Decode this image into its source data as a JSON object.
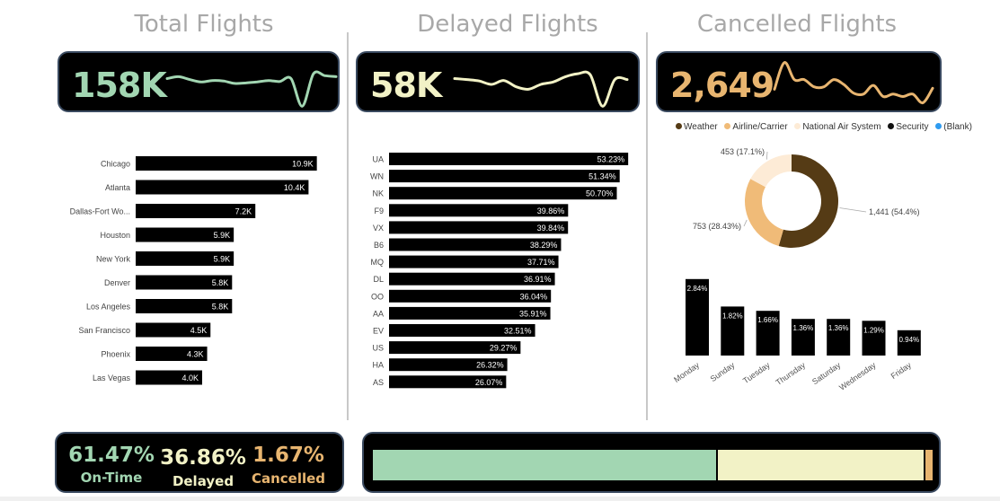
{
  "colors": {
    "ontime": "#a2d6b2",
    "delayed": "#f2f2c6",
    "cancelled": "#e8b570",
    "bar": "#000000",
    "weather": "#553b15",
    "airline": "#f0bb78",
    "nas": "#fdebd6",
    "security": "#111111",
    "blank": "#2f9bf0"
  },
  "titles": {
    "total": "Total Flights",
    "delayed": "Delayed Flights",
    "cancelled": "Cancelled Flights"
  },
  "kpis": {
    "total": "158K",
    "delayed": "58K",
    "cancelled": "2,649"
  },
  "summary": {
    "ontime_pct": "61.47%",
    "ontime_label": "On-Time",
    "delayed_pct": "36.86%",
    "delayed_label": "Delayed",
    "cancelled_pct": "1.67%",
    "cancelled_label": "Cancelled"
  },
  "chart_data": [
    {
      "type": "line",
      "series": [
        {
          "values": [
            0.62,
            0.66,
            0.6,
            0.55,
            0.58,
            0.57,
            0.52,
            0.53,
            0.55,
            0.58,
            0.56,
            0.62,
            0.05,
            0.72,
            0.68,
            0.66
          ]
        }
      ]
    },
    {
      "type": "line",
      "series": [
        {
          "values": [
            0.62,
            0.6,
            0.57,
            0.5,
            0.58,
            0.45,
            0.4,
            0.5,
            0.55,
            0.66,
            0.72,
            0.7,
            0.05,
            0.6,
            0.6
          ]
        }
      ]
    },
    {
      "type": "line",
      "series": [
        {
          "values": [
            0.4,
            0.95,
            0.6,
            0.6,
            0.45,
            0.45,
            0.6,
            0.5,
            0.32,
            0.3,
            0.48,
            0.25,
            0.3,
            0.25,
            0.3,
            0.12,
            0.42
          ]
        }
      ]
    },
    {
      "type": "bar",
      "orientation": "horizontal",
      "categories": [
        "Chicago",
        "Atlanta",
        "Dallas-Fort Wo...",
        "Houston",
        "New York",
        "Denver",
        "Los Angeles",
        "San Francisco",
        "Phoenix",
        "Las Vegas"
      ],
      "values": [
        10.9,
        10.4,
        7.2,
        5.9,
        5.9,
        5.8,
        5.8,
        4.5,
        4.3,
        4.0
      ],
      "labels": [
        "10.9K",
        "10.4K",
        "7.2K",
        "5.9K",
        "5.9K",
        "5.8K",
        "5.8K",
        "4.5K",
        "4.3K",
        "4.0K"
      ]
    },
    {
      "type": "bar",
      "orientation": "horizontal",
      "categories": [
        "UA",
        "WN",
        "NK",
        "F9",
        "VX",
        "B6",
        "MQ",
        "DL",
        "OO",
        "AA",
        "EV",
        "US",
        "HA",
        "AS"
      ],
      "values": [
        53.23,
        51.34,
        50.7,
        39.86,
        39.84,
        38.29,
        37.71,
        36.91,
        36.04,
        35.91,
        32.51,
        29.27,
        26.32,
        26.07
      ],
      "labels": [
        "53.23%",
        "51.34%",
        "50.70%",
        "39.86%",
        "39.84%",
        "38.29%",
        "37.71%",
        "36.91%",
        "36.04%",
        "35.91%",
        "32.51%",
        "29.27%",
        "26.32%",
        "26.07%"
      ]
    },
    {
      "type": "pie",
      "legend": [
        "Weather",
        "Airline/Carrier",
        "National Air System",
        "Security",
        "(Blank)"
      ],
      "legend_colors": [
        "#553b15",
        "#f0bb78",
        "#fdebd6",
        "#111111",
        "#2f9bf0"
      ],
      "slices": [
        {
          "name": "Weather",
          "value": 1441,
          "label": "1,441 (54.4%)"
        },
        {
          "name": "Airline/Carrier",
          "value": 753,
          "label": "753 (28.43%)"
        },
        {
          "name": "National Air System",
          "value": 453,
          "label": "453 (17.1%)"
        }
      ]
    },
    {
      "type": "bar",
      "categories": [
        "Monday",
        "Sunday",
        "Tuesday",
        "Thursday",
        "Saturday",
        "Wednesday",
        "Friday"
      ],
      "values": [
        2.84,
        1.82,
        1.66,
        1.36,
        1.36,
        1.29,
        0.94
      ],
      "labels": [
        "2.84%",
        "1.82%",
        "1.66%",
        "1.36%",
        "1.36%",
        "1.29%",
        "0.94%"
      ]
    },
    {
      "type": "bar",
      "orientation": "stacked-horizontal",
      "series": [
        {
          "values": [
            61.47
          ]
        },
        {
          "values": [
            36.86
          ]
        },
        {
          "values": [
            1.67
          ]
        }
      ]
    }
  ]
}
